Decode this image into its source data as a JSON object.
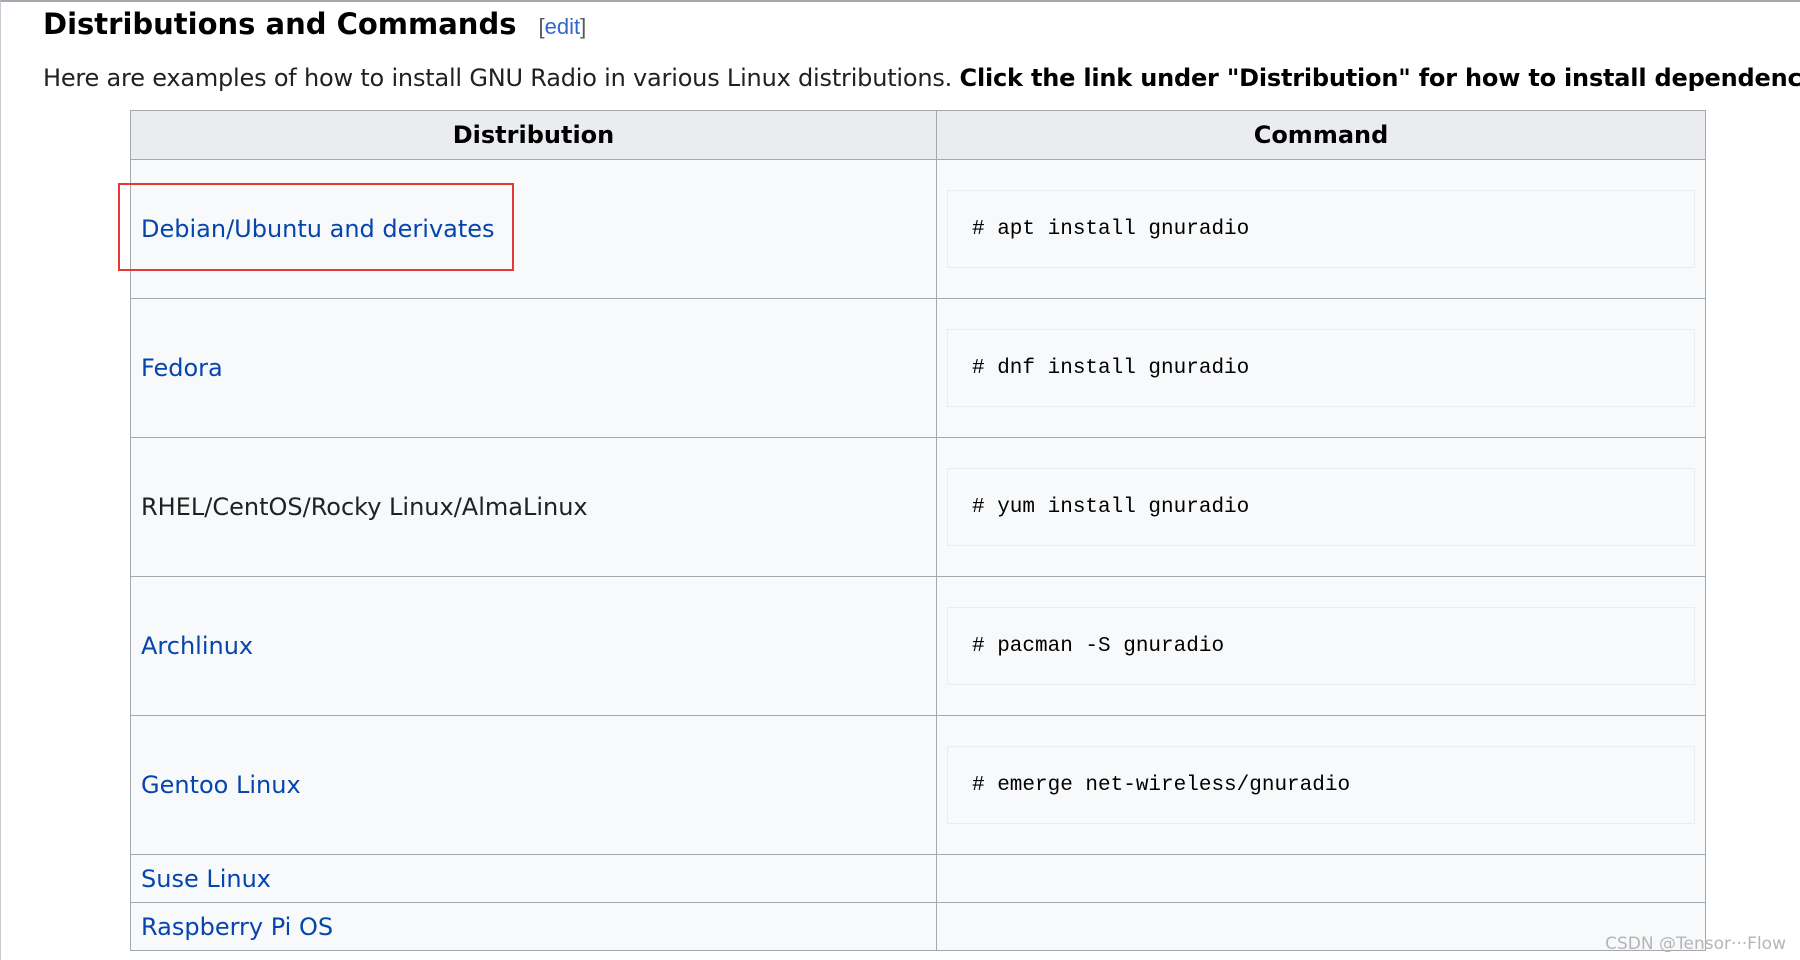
{
  "section": {
    "title": "Distributions and Commands",
    "edit_open": "[",
    "edit_label": "edit",
    "edit_close": "]"
  },
  "intro": {
    "text": "Here are examples of how to install GNU Radio in various Linux distributions. ",
    "bold_text": "Click the link under \"Distribution\" for how to install dependencies."
  },
  "table": {
    "headers": {
      "distribution": "Distribution",
      "command": "Command"
    },
    "rows": [
      {
        "distribution": "Debian/Ubuntu and derivates",
        "is_link": true,
        "command": "# apt install gnuradio"
      },
      {
        "distribution": "Fedora",
        "is_link": true,
        "command": "# dnf install gnuradio"
      },
      {
        "distribution": "RHEL/CentOS/Rocky Linux/AlmaLinux",
        "is_link": false,
        "command": "# yum install gnuradio"
      },
      {
        "distribution": "Archlinux",
        "is_link": true,
        "command": "# pacman -S gnuradio"
      },
      {
        "distribution": "Gentoo Linux",
        "is_link": true,
        "command": "# emerge net-wireless/gnuradio"
      },
      {
        "distribution": "Suse Linux",
        "is_link": true,
        "command": ""
      },
      {
        "distribution": "Raspberry Pi OS",
        "is_link": true,
        "command": ""
      }
    ]
  },
  "annotation": {
    "highlight_color": "#e53935"
  },
  "watermark": "CSDN @Tensor···Flow",
  "colors": {
    "link": "#0645ad",
    "header_bg": "#eaecf0",
    "table_bg": "#f8f9fa",
    "border": "#a2a9b1"
  }
}
